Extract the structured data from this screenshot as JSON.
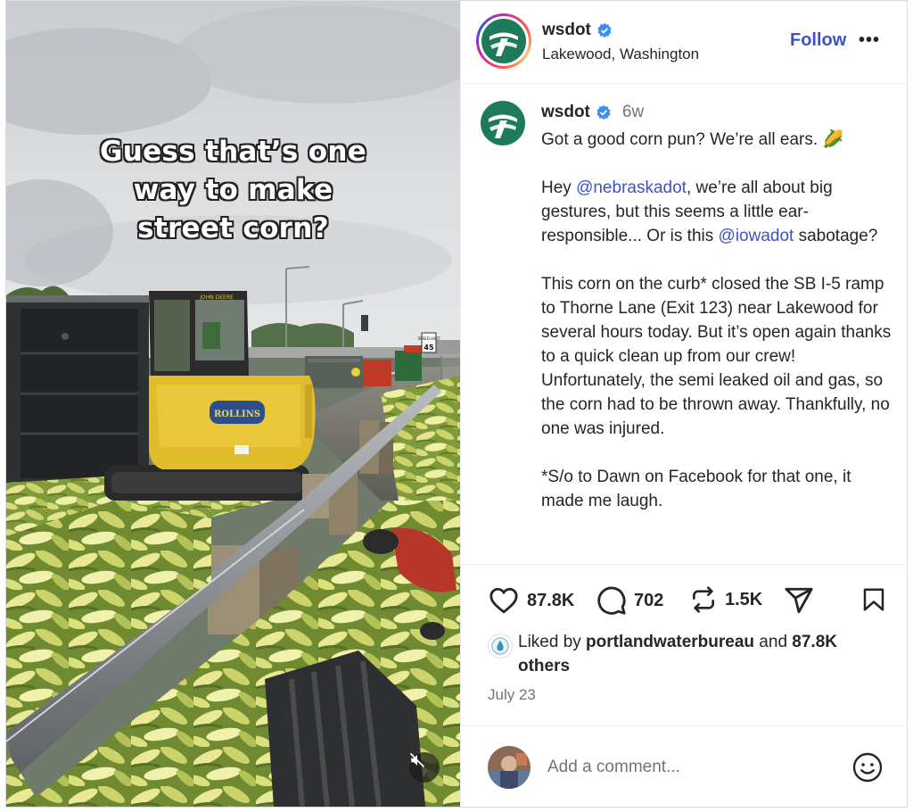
{
  "media": {
    "overlay_caption_lines": [
      "Guess that’s one",
      "way to make",
      "street corn?"
    ],
    "signs": {
      "excavator_brand": "JOHN DEERE",
      "excavator_decal": "ROLLINS",
      "speed_limit_label": "SPEED LIMIT",
      "speed_limit_value": "45"
    },
    "mute_icon": "speaker-muted-icon"
  },
  "header": {
    "username": "wsdot",
    "verified_icon": "verified-badge-icon",
    "location": "Lakewood, Washington",
    "follow_label": "Follow",
    "more_label": "•••"
  },
  "caption": {
    "username": "wsdot",
    "time": "6w",
    "line1": "Got a good corn pun? We’re all ears. 🌽",
    "p2_before": "Hey ",
    "p2_mention1": "@nebraskadot",
    "p2_middle": ", we’re all about big gestures, but this seems a little ear-responsible... Or is this ",
    "p2_mention2": "@iowadot",
    "p2_after": " sabotage?",
    "p3": "This corn on the curb* closed the SB I-5 ramp to Thorne Lane (Exit 123) near Lakewood for several hours today. But it’s open again thanks to a quick clean up from our crew! Unfortunately, the semi leaked oil and gas, so the corn had to be thrown away. Thankfully, no one was injured.",
    "p4": "*S/o to Dawn on Facebook for that one, it made me laugh."
  },
  "actions": {
    "likes_count": "87.8K",
    "comments_count": "702",
    "reposts_count": "1.5K",
    "like_icon": "heart-icon",
    "comment_icon": "comment-bubble-icon",
    "repost_icon": "repost-icon",
    "share_icon": "send-icon",
    "save_icon": "bookmark-icon"
  },
  "liked_by": {
    "prefix": "Liked by ",
    "user": "portlandwaterbureau",
    "middle": " and ",
    "count": "87.8K",
    "suffix": " others"
  },
  "date": "July 23",
  "comment": {
    "placeholder": "Add a comment...",
    "emoji_icon": "smiley-icon"
  },
  "colors": {
    "accent_blue": "#3d52c5",
    "wsdot_green": "#1d7a5a",
    "muted_text": "#737373"
  }
}
